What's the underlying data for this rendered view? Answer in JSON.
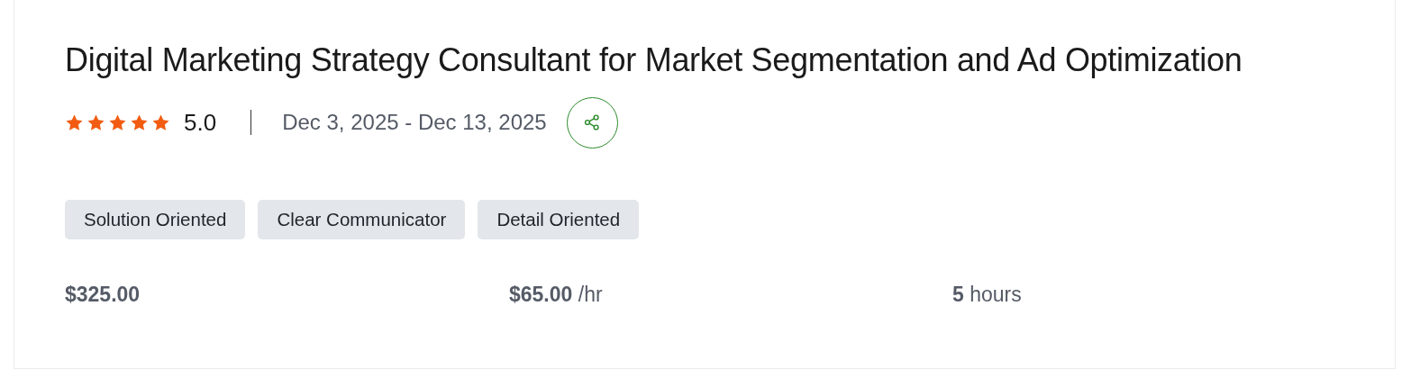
{
  "title": "Digital Marketing Strategy Consultant for Market Segmentation and Ad Optimization",
  "rating": {
    "stars": 5,
    "score": "5.0"
  },
  "dates": "Dec 3, 2025 - Dec 13, 2025",
  "tags": [
    "Solution Oriented",
    "Clear Communicator",
    "Detail Oriented"
  ],
  "stats": [
    {
      "kind": "bold",
      "text": "$325.00"
    },
    {
      "kind": "rich",
      "text": "**$65.00** /hr"
    },
    {
      "kind": "rich",
      "text": "**5** hours"
    }
  ]
}
